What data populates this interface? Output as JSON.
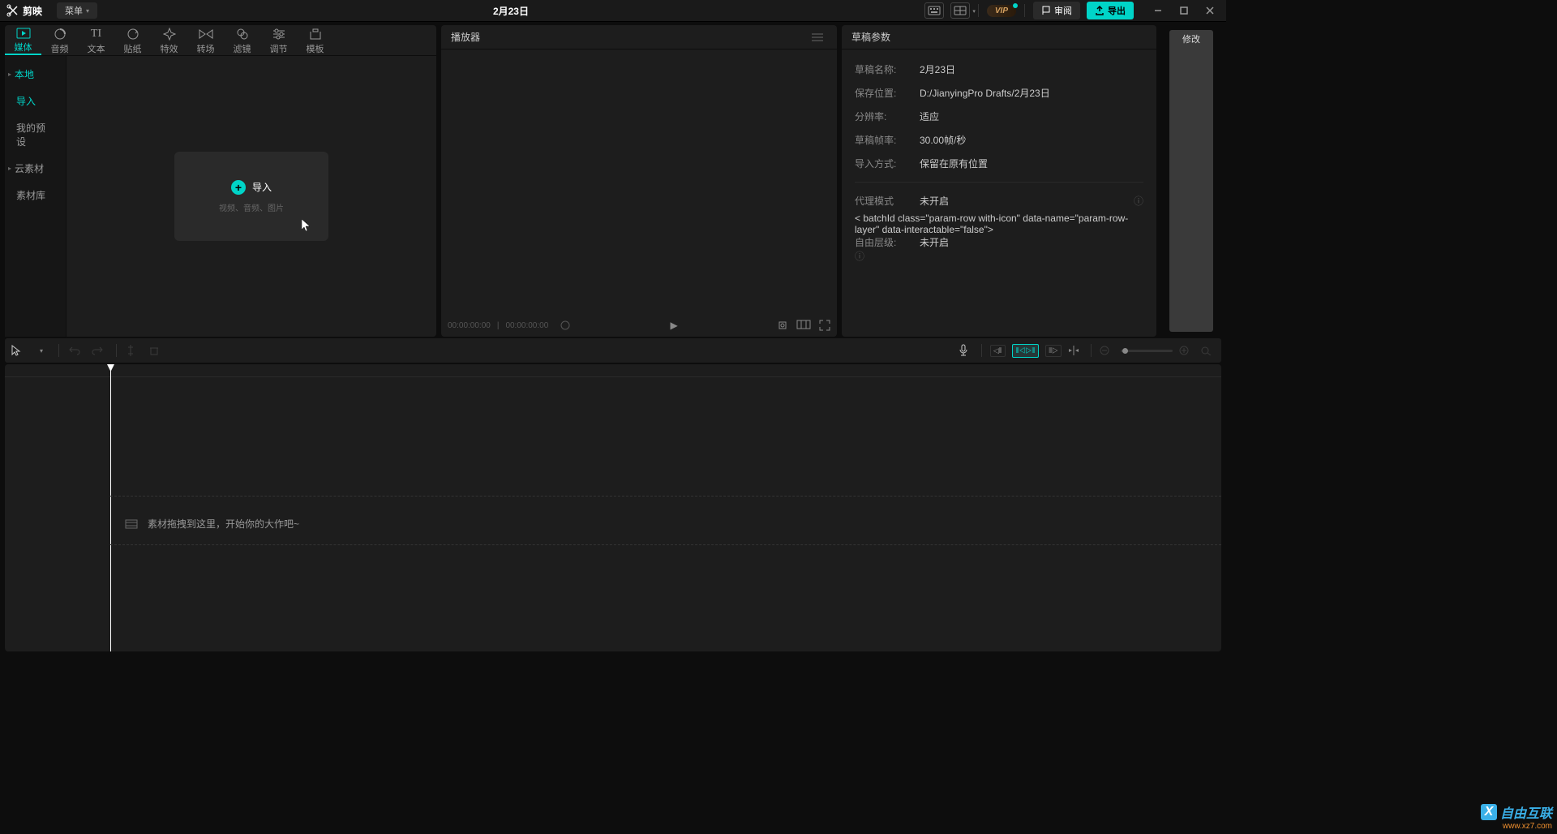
{
  "titlebar": {
    "app_name": "剪映",
    "menu_label": "菜单",
    "project_title": "2月23日",
    "vip_label": "VIP",
    "review_label": "审阅",
    "export_label": "导出"
  },
  "top_tabs": [
    {
      "label": "媒体",
      "icon": "▶"
    },
    {
      "label": "音频",
      "icon": "◔"
    },
    {
      "label": "文本",
      "icon": "TI"
    },
    {
      "label": "贴纸",
      "icon": "◷"
    },
    {
      "label": "特效",
      "icon": "✦"
    },
    {
      "label": "转场",
      "icon": "⋈"
    },
    {
      "label": "滤镜",
      "icon": "◉"
    },
    {
      "label": "调节",
      "icon": "≡"
    },
    {
      "label": "模板",
      "icon": "▢"
    }
  ],
  "side_nav": [
    {
      "label": "本地",
      "active": true,
      "expandable": true
    },
    {
      "label": "导入"
    },
    {
      "label": "我的预设"
    },
    {
      "label": "云素材",
      "expandable": true
    },
    {
      "label": "素材库"
    }
  ],
  "import_card": {
    "label": "导入",
    "sub": "视频、音频、图片"
  },
  "player": {
    "title": "播放器",
    "time_current": "00:00:00:00",
    "time_total": "00:00:00:00"
  },
  "params": {
    "title": "草稿参数",
    "rows": [
      {
        "label": "草稿名称:",
        "value": "2月23日"
      },
      {
        "label": "保存位置:",
        "value": "D:/JianyingPro Drafts/2月23日"
      },
      {
        "label": "分辨率:",
        "value": "适应"
      },
      {
        "label": "草稿帧率:",
        "value": "30.00帧/秒"
      },
      {
        "label": "导入方式:",
        "value": "保留在原有位置"
      }
    ],
    "extra_rows": [
      {
        "label": "代理模式",
        "value": "未开启"
      },
      {
        "label": "自由层级:",
        "value": "未开启"
      }
    ],
    "modify_label": "修改"
  },
  "timeline": {
    "hint": "素材拖拽到这里，开始你的大作吧~"
  },
  "watermark": {
    "brand": "自由互联",
    "url": "www.xz7.com"
  }
}
